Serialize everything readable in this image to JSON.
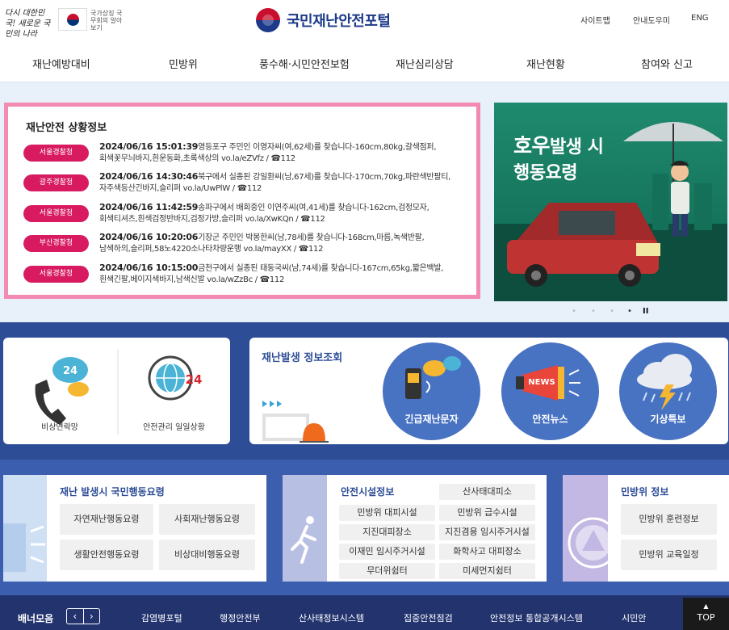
{
  "header": {
    "slogan": "다시 대한민국! 새로운 국민의 나라",
    "nat_label": "국가상징 국무회의 알아보기",
    "brand": "국민재난안전포털",
    "util": [
      "사이트맵",
      "안내도우미",
      "ENG"
    ]
  },
  "gnb": [
    "재난예방대비",
    "민방위",
    "풍수해·시민안전보험",
    "재난심리상담",
    "재난현황",
    "참여와 신고"
  ],
  "situation": {
    "title": "재난안전 상황정보",
    "alerts": [
      {
        "agency": "서울경찰청",
        "datetime": "2024/06/16 15:01:39",
        "line1": "영등포구 주민인 이영자씨(여,62세)를 찾습니다-160cm,80kg,갈색점퍼,",
        "line2": "회색꽃무늬바지,흰운동화,초록색상의 vo.la/eZVfz / ☎112"
      },
      {
        "agency": "광주경찰청",
        "datetime": "2024/06/16 14:30:46",
        "line1": "북구에서 실종된 강일환씨(남,67세)를 찾습니다-170cm,70kg,파란색반팔티,",
        "line2": "자주색등산긴바지,슬리퍼 vo.la/UwPlW / ☎112"
      },
      {
        "agency": "서울경찰청",
        "datetime": "2024/06/16 11:42:59",
        "line1": "송파구에서 배회중인 이연주씨(여,41세)를 찾습니다-162cm,검정모자,",
        "line2": "회색티셔츠,흰색검정반바지,검정가방,슬리퍼 vo.la/XwKQn / ☎112"
      },
      {
        "agency": "부산경찰청",
        "datetime": "2024/06/16 10:20:06",
        "line1": "기장군 주민인 박봉한씨(남,78세)를 찾습니다-168cm,마름,녹색반팔,",
        "line2": "남색하의,슬리퍼,58노4220소나타차량운행 vo.la/mayXX / ☎112"
      },
      {
        "agency": "서울경찰청",
        "datetime": "2024/06/16 10:15:00",
        "line1": "금천구에서 실종된 태동국씨(남,74세)를 찾습니다-167cm,65kg,짧은백발,",
        "line2": "흰색긴팔,베이지색바지,남색신발 vo.la/wZzBc / ☎112"
      }
    ]
  },
  "banner": {
    "title_big": "호우",
    "title_rest": "발생 시",
    "title_line2": "행동요령",
    "pager": [
      "•",
      "•",
      "•",
      "•",
      "II"
    ]
  },
  "emergency": {
    "contact_label": "비상연락망",
    "daily_label": "안전관리 일일상황"
  },
  "info": {
    "title": "재난발생 정보조회",
    "circles": [
      "긴급재난문자",
      "안전뉴스",
      "기상특보"
    ],
    "news_badge": "NEWS",
    "badge_24": "24"
  },
  "action": {
    "title": "재난 발생시 국민행동요령",
    "buttons": [
      "자연재난행동요령",
      "사회재난행동요령",
      "생활안전행동요령",
      "비상대비행동요령"
    ]
  },
  "facility": {
    "title": "안전시설정보",
    "buttons": [
      "산사태대피소",
      "민방위 대피시설",
      "민방위 급수시설",
      "지진대피장소",
      "지진겸용 임시주거시설",
      "이재민 임시주거시설",
      "화학사고 대피장소",
      "무더위쉼터",
      "미세먼지쉼터"
    ]
  },
  "civil": {
    "title": "민방위 정보",
    "buttons": [
      "민방위 훈련정보",
      "민방위 교육일정"
    ]
  },
  "bottom": {
    "label": "배너모음",
    "links": [
      "감염병포털",
      "행정안전부",
      "산사태정보시스템",
      "집중안전점검",
      "안전정보 통합공개시스템",
      "시민안"
    ],
    "top": "TOP"
  },
  "colors": {
    "brand": "#1d3a8a",
    "badge": "#d81b60",
    "band": "#2e4d97",
    "circle": "#4872c2",
    "pink_border": "#f28ab2"
  }
}
